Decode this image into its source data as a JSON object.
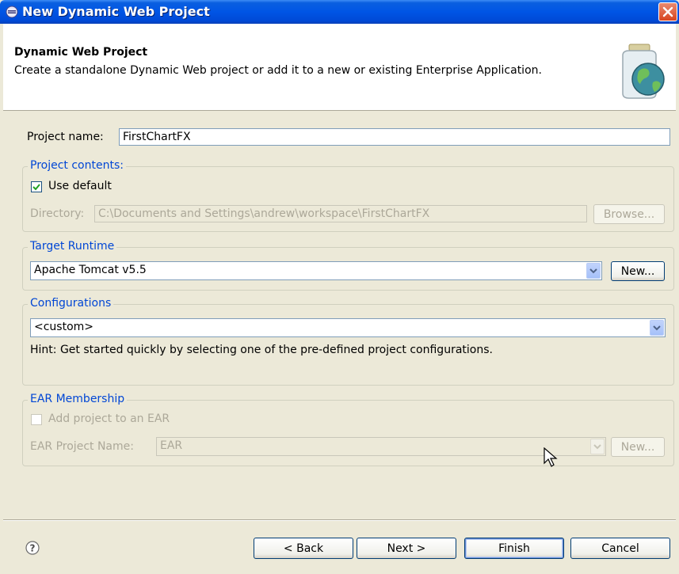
{
  "window": {
    "title": "New Dynamic Web Project",
    "icon": "eclipse-wizard-icon",
    "close_icon": "close-icon"
  },
  "banner": {
    "title": "Dynamic Web Project",
    "description": "Create a standalone Dynamic Web project or add it to a new or existing Enterprise Application.",
    "icon": "web-project-jar-globe-icon"
  },
  "project_name": {
    "label": "Project name:",
    "value": "FirstChartFX"
  },
  "project_contents": {
    "legend": "Project contents:",
    "use_default_label": "Use default",
    "use_default_checked": true,
    "directory_label": "Directory:",
    "directory_value": "C:\\Documents and Settings\\andrew\\workspace\\FirstChartFX",
    "browse_label": "Browse..."
  },
  "target_runtime": {
    "legend": "Target Runtime",
    "selected": "Apache Tomcat v5.5",
    "new_label": "New..."
  },
  "configurations": {
    "legend": "Configurations",
    "selected": "<custom>",
    "hint": "Hint: Get started quickly by selecting one of the pre-defined project configurations."
  },
  "ear_membership": {
    "legend": "EAR Membership",
    "add_label": "Add project to an EAR",
    "add_checked": false,
    "ear_name_label": "EAR Project Name:",
    "ear_name_value": "EAR",
    "new_label": "New..."
  },
  "footer": {
    "help_icon": "help-icon",
    "back_label": "< Back",
    "next_label": "Next >",
    "finish_label": "Finish",
    "cancel_label": "Cancel"
  },
  "colors": {
    "titlebar": "#0055e5",
    "legend_blue": "#0046d5",
    "dialog_bg": "#ece9d8"
  }
}
